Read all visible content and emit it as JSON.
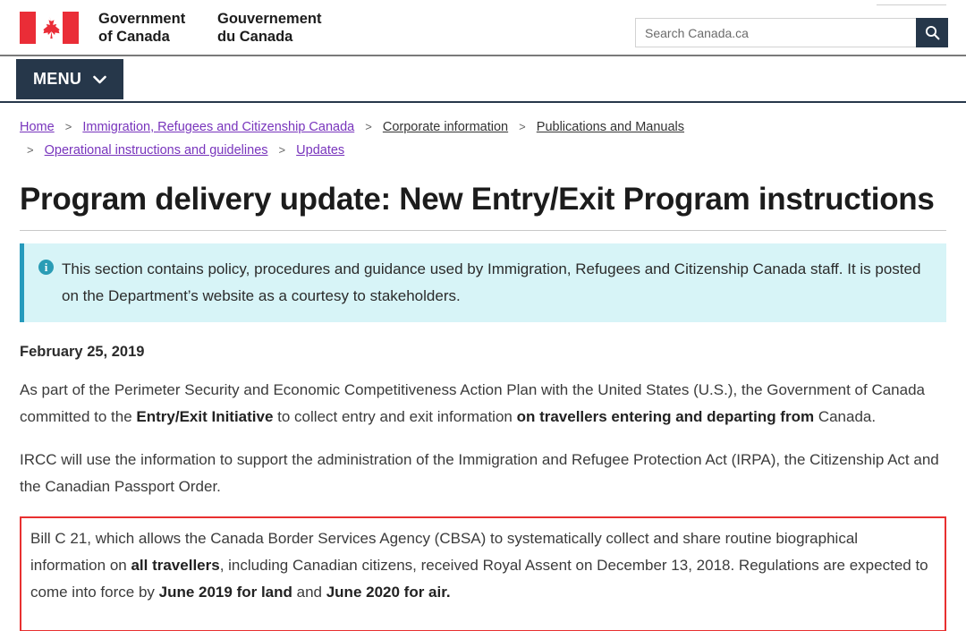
{
  "header": {
    "flag_icon": "canada-flag-icon",
    "brand_en_line1": "Government",
    "brand_en_line2": "of Canada",
    "brand_fr_line1": "Gouvernement",
    "brand_fr_line2": "du Canada",
    "lang_toggle": "",
    "search": {
      "placeholder": "Search Canada.ca",
      "value": "",
      "button_icon": "search-icon"
    }
  },
  "menu": {
    "label": "MENU",
    "chevron_icon": "chevron-down-icon"
  },
  "breadcrumb": {
    "separator": ">",
    "items": [
      {
        "label": "Home",
        "state": "visited"
      },
      {
        "label": "Immigration, Refugees and Citizenship Canada",
        "state": "visited"
      },
      {
        "label": "Corporate information",
        "state": "plain"
      },
      {
        "label": "Publications and Manuals",
        "state": "plain"
      },
      {
        "label": "Operational instructions and guidelines",
        "state": "visited"
      },
      {
        "label": "Updates",
        "state": "visited"
      }
    ]
  },
  "main": {
    "title": "Program delivery update: New Entry/Exit Program instructions",
    "callout": {
      "icon": "info-icon",
      "line1": "This section contains policy, procedures and guidance used by Immigration, Refugees and Citizenship Canada staff.",
      "line2": "It is posted on the Department’s website as a courtesy to stakeholders."
    },
    "date": "February 25, 2019",
    "paragraph1": {
      "part1": "As part of the Perimeter Security and Economic Competitiveness Action Plan with the United States (U.S.), the Government of Canada committed to the ",
      "bold1": "Entry/Exit Initiative",
      "part2": " to collect entry and exit information ",
      "bold2": "on travellers entering and departing from",
      "part3": " Canada."
    },
    "paragraph2": "IRCC will use the information to support the administration of the Immigration and Refugee Protection Act (IRPA), the Citizenship Act and the Canadian Passport Order.",
    "highlight": {
      "part1": "Bill C 21, which allows the Canada Border Services Agency (CBSA) to systematically collect and share routine biographical information on ",
      "bold1": "all travellers",
      "part2": ", including Canadian citizens, received Royal Assent on December 13, 2018. Regulations are expected to come into force by ",
      "bold2": "June 2019 for land",
      "part3": " and ",
      "bold3": "June 2020 for air.",
      "border_color": "#e83030"
    }
  },
  "colors": {
    "navy": "#26374a",
    "callout_bg": "#d7f4f7",
    "callout_accent": "#269abc",
    "link_visited": "#7834bc",
    "flag_red": "#ea2d37"
  }
}
